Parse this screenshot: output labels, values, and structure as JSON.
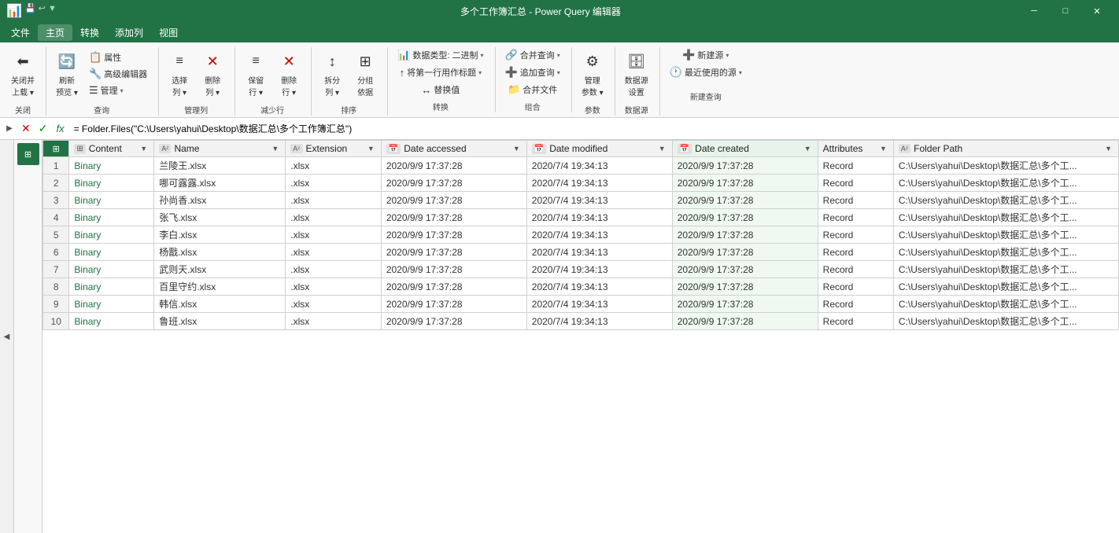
{
  "titleBar": {
    "appIcon": "📊",
    "title": "多个工作簿汇总 - Power Query 编辑器",
    "quickAccess": [
      "💾",
      "↩",
      "▼"
    ],
    "windowControls": [
      "─",
      "□",
      "✕"
    ]
  },
  "menuBar": {
    "items": [
      "文件",
      "主页",
      "转换",
      "添加列",
      "视图"
    ]
  },
  "ribbon": {
    "groups": [
      {
        "label": "关闭",
        "buttons": [
          {
            "type": "large",
            "icon": "⬅",
            "label": "关闭并\n上载▾"
          }
        ]
      },
      {
        "label": "查询",
        "buttons": [
          {
            "type": "large",
            "icon": "🔄",
            "label": "刷新\n预览▾"
          },
          {
            "type": "small-col",
            "items": [
              {
                "icon": "📋",
                "label": "属性"
              },
              {
                "icon": "🔧",
                "label": "高级编辑器"
              },
              {
                "icon": "☰",
                "label": "管理▾"
              }
            ]
          }
        ]
      },
      {
        "label": "管理列",
        "buttons": [
          {
            "type": "large",
            "icon": "≡▾",
            "label": "选择\n列▾"
          },
          {
            "type": "large",
            "icon": "✕",
            "label": "删除\n列▾"
          }
        ]
      },
      {
        "label": "减少行",
        "buttons": [
          {
            "type": "large",
            "icon": "≡",
            "label": "保留\n行▾"
          },
          {
            "type": "large",
            "icon": "✕",
            "label": "删除\n行▾"
          }
        ]
      },
      {
        "label": "排序",
        "buttons": [
          {
            "type": "large",
            "icon": "↕",
            "label": "拆分\n列▾"
          },
          {
            "type": "large",
            "icon": "⊞",
            "label": "分组\n依据"
          }
        ]
      },
      {
        "label": "转换",
        "buttons": [
          {
            "type": "small",
            "icon": "📊",
            "label": "数据类型: 二进制▾"
          },
          {
            "type": "small",
            "icon": "↑",
            "label": "将第一行用作标题▾"
          },
          {
            "type": "small",
            "icon": "↔",
            "label": "替换值"
          }
        ]
      },
      {
        "label": "组合",
        "buttons": [
          {
            "type": "small",
            "icon": "🔗",
            "label": "合并查询▾"
          },
          {
            "type": "small",
            "icon": "➕",
            "label": "追加查询▾"
          },
          {
            "type": "small",
            "icon": "📁",
            "label": "合并文件"
          }
        ]
      },
      {
        "label": "参数",
        "buttons": [
          {
            "type": "large",
            "icon": "⚙",
            "label": "管理\n参数▾"
          }
        ]
      },
      {
        "label": "数据源",
        "buttons": [
          {
            "type": "large",
            "icon": "🗄",
            "label": "数据源\n设置"
          }
        ]
      },
      {
        "label": "新建查询",
        "buttons": [
          {
            "type": "small",
            "icon": "➕",
            "label": "新建源▾"
          },
          {
            "type": "small",
            "icon": "🕐",
            "label": "最近使用的源▾"
          }
        ]
      }
    ]
  },
  "formulaBar": {
    "formula": "= Folder.Files(\"C:\\Users\\yahui\\Desktop\\数据汇总\\多个工作簿汇总\")"
  },
  "table": {
    "columns": [
      {
        "id": "row-num",
        "label": "",
        "type": ""
      },
      {
        "id": "content",
        "label": "Content",
        "type": "⊞",
        "filterIcon": "▼"
      },
      {
        "id": "name",
        "label": "Name",
        "type": "Aᶻ",
        "filterIcon": "▼"
      },
      {
        "id": "extension",
        "label": "Extension",
        "type": "Aᶻ",
        "filterIcon": "▼"
      },
      {
        "id": "date-accessed",
        "label": "Date accessed",
        "type": "📅",
        "filterIcon": "▼"
      },
      {
        "id": "date-modified",
        "label": "Date modified",
        "type": "📅",
        "filterIcon": "▼"
      },
      {
        "id": "date-created",
        "label": "Date created",
        "type": "📅",
        "filterIcon": "▼"
      },
      {
        "id": "attributes",
        "label": "Attributes",
        "type": "",
        "filterIcon": "▼"
      },
      {
        "id": "folder-path",
        "label": "Folder Path",
        "type": "Aᶻ",
        "filterIcon": "▼"
      }
    ],
    "rows": [
      {
        "num": 1,
        "content": "Binary",
        "name": "兰陵王.xlsx",
        "extension": ".xlsx",
        "dateAccessed": "2020/9/9 17:37:28",
        "dateModified": "2020/7/4 19:34:13",
        "dateCreated": "2020/9/9 17:37:28",
        "attributes": "Record",
        "folderPath": "C:\\Users\\yahui\\Desktop\\数据汇总\\多个工..."
      },
      {
        "num": 2,
        "content": "Binary",
        "name": "哪可露露.xlsx",
        "extension": ".xlsx",
        "dateAccessed": "2020/9/9 17:37:28",
        "dateModified": "2020/7/4 19:34:13",
        "dateCreated": "2020/9/9 17:37:28",
        "attributes": "Record",
        "folderPath": "C:\\Users\\yahui\\Desktop\\数据汇总\\多个工..."
      },
      {
        "num": 3,
        "content": "Binary",
        "name": "孙尚香.xlsx",
        "extension": ".xlsx",
        "dateAccessed": "2020/9/9 17:37:28",
        "dateModified": "2020/7/4 19:34:13",
        "dateCreated": "2020/9/9 17:37:28",
        "attributes": "Record",
        "folderPath": "C:\\Users\\yahui\\Desktop\\数据汇总\\多个工..."
      },
      {
        "num": 4,
        "content": "Binary",
        "name": "张飞.xlsx",
        "extension": ".xlsx",
        "dateAccessed": "2020/9/9 17:37:28",
        "dateModified": "2020/7/4 19:34:13",
        "dateCreated": "2020/9/9 17:37:28",
        "attributes": "Record",
        "folderPath": "C:\\Users\\yahui\\Desktop\\数据汇总\\多个工..."
      },
      {
        "num": 5,
        "content": "Binary",
        "name": "李白.xlsx",
        "extension": ".xlsx",
        "dateAccessed": "2020/9/9 17:37:28",
        "dateModified": "2020/7/4 19:34:13",
        "dateCreated": "2020/9/9 17:37:28",
        "attributes": "Record",
        "folderPath": "C:\\Users\\yahui\\Desktop\\数据汇总\\多个工..."
      },
      {
        "num": 6,
        "content": "Binary",
        "name": "杨戬.xlsx",
        "extension": ".xlsx",
        "dateAccessed": "2020/9/9 17:37:28",
        "dateModified": "2020/7/4 19:34:13",
        "dateCreated": "2020/9/9 17:37:28",
        "attributes": "Record",
        "folderPath": "C:\\Users\\yahui\\Desktop\\数据汇总\\多个工..."
      },
      {
        "num": 7,
        "content": "Binary",
        "name": "武则天.xlsx",
        "extension": ".xlsx",
        "dateAccessed": "2020/9/9 17:37:28",
        "dateModified": "2020/7/4 19:34:13",
        "dateCreated": "2020/9/9 17:37:28",
        "attributes": "Record",
        "folderPath": "C:\\Users\\yahui\\Desktop\\数据汇总\\多个工..."
      },
      {
        "num": 8,
        "content": "Binary",
        "name": "百里守约.xlsx",
        "extension": ".xlsx",
        "dateAccessed": "2020/9/9 17:37:28",
        "dateModified": "2020/7/4 19:34:13",
        "dateCreated": "2020/9/9 17:37:28",
        "attributes": "Record",
        "folderPath": "C:\\Users\\yahui\\Desktop\\数据汇总\\多个工..."
      },
      {
        "num": 9,
        "content": "Binary",
        "name": "韩信.xlsx",
        "extension": ".xlsx",
        "dateAccessed": "2020/9/9 17:37:28",
        "dateModified": "2020/7/4 19:34:13",
        "dateCreated": "2020/9/9 17:37:28",
        "attributes": "Record",
        "folderPath": "C:\\Users\\yahui\\Desktop\\数据汇总\\多个工..."
      },
      {
        "num": 10,
        "content": "Binary",
        "name": "鲁班.xlsx",
        "extension": ".xlsx",
        "dateAccessed": "2020/9/9 17:37:28",
        "dateModified": "2020/7/4 19:34:13",
        "dateCreated": "2020/9/9 17:37:28",
        "attributes": "Record",
        "folderPath": "C:\\Users\\yahui\\Desktop\\数据汇总\\多个工..."
      }
    ]
  },
  "labels": {
    "close": "关闭并",
    "close2": "上载",
    "refresh": "刷新",
    "preview": "预览",
    "properties": "属性",
    "advEditor": "高级编辑器",
    "manage": "管理",
    "selectCol": "选择",
    "selectCol2": "列",
    "deleteCol": "删除",
    "deleteCol2": "列",
    "keepRow": "保留",
    "keepRow2": "行",
    "deleteRow": "删除",
    "deleteRow2": "行",
    "splitCol": "拆分",
    "splitCol2": "列",
    "groupBy": "分组",
    "groupBy2": "依据",
    "dataType": "数据类型: 二进制",
    "firstRow": "将第一行用作标题",
    "replace": "替换值",
    "mergeQuery": "合并查询",
    "appendQuery": "追加查询",
    "mergeFile": "合并文件",
    "manageParam": "管理",
    "manageParam2": "参数",
    "dataSrc": "数据源",
    "dataSrc2": "设置",
    "newSrc": "新建源",
    "recentSrc": "最近使用的源",
    "queryLabel": "查询",
    "manageColLabel": "管理列",
    "reduceRowLabel": "减少行",
    "sortLabel": "排序",
    "transformLabel": "转换",
    "combineLabel": "组合",
    "paramLabel": "参数",
    "dataSrcLabel": "数据源",
    "newQueryLabel": "新建查询",
    "closeLabel": "关闭"
  }
}
